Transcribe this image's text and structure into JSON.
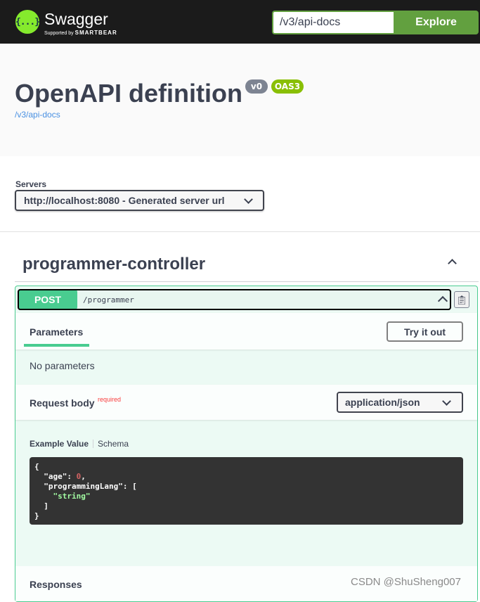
{
  "topbar": {
    "logo_glyph": "{...}",
    "logo_title": "Swagger",
    "logo_subtitle_prefix": "Supported by",
    "logo_subtitle_brand": "SMARTBEAR",
    "url_value": "/v3/api-docs",
    "explore_label": "Explore"
  },
  "info": {
    "title": "OpenAPI definition",
    "version_badge": "v0",
    "oas_badge": "OAS3",
    "spec_url": "/v3/api-docs"
  },
  "servers": {
    "label": "Servers",
    "selected": "http://localhost:8080 - Generated server url"
  },
  "tag": {
    "name": "programmer-controller"
  },
  "operation": {
    "method": "POST",
    "path": "/programmer",
    "parameters_tab": "Parameters",
    "try_it_out": "Try it out",
    "no_parameters": "No parameters",
    "request_body_title": "Request body",
    "required_label": "required",
    "content_type": "application/json",
    "example_tab": "Example Value",
    "schema_tab": "Schema",
    "example_lines": {
      "open": "{",
      "age_key": "  \"age\": ",
      "age_value": "0",
      "age_tail": ",",
      "lang_key": "  \"programmingLang\": [",
      "lang_item": "    \"string\"",
      "array_close": "  ]",
      "close": "}"
    },
    "responses_title": "Responses"
  },
  "watermark": "CSDN @ShuSheng007",
  "colors": {
    "post": "#49cc90",
    "explore": "#62a03f",
    "logo": "#85ea2d",
    "oas_badge": "#89bf04",
    "version_badge": "#7d8492"
  }
}
